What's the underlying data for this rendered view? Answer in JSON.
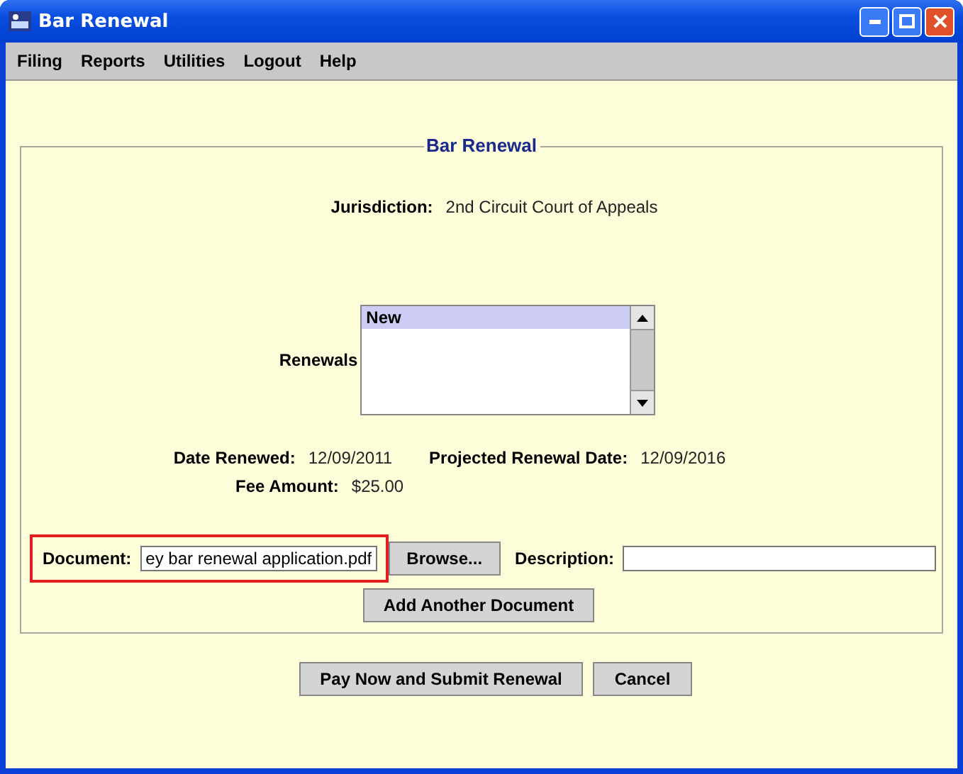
{
  "window": {
    "title": "Bar Renewal"
  },
  "menu": [
    "Filing",
    "Reports",
    "Utilities",
    "Logout",
    "Help"
  ],
  "panel": {
    "title": "Bar Renewal"
  },
  "jurisdiction": {
    "label": "Jurisdiction:",
    "value": "2nd Circuit Court of Appeals"
  },
  "renewals": {
    "label": "Renewals",
    "items": [
      {
        "text": "New",
        "selected": true
      }
    ]
  },
  "dates": [
    {
      "label": "Date Renewed:",
      "value": "12/09/2011"
    },
    {
      "label": "Projected Renewal Date:",
      "value": "12/09/2016"
    }
  ],
  "fee": {
    "label": "Fee Amount:",
    "value": "$25.00"
  },
  "document": {
    "label": "Document:",
    "value": "ey bar renewal application.pdf",
    "highlighted": true
  },
  "browse_button": "Browse...",
  "description": {
    "label": "Description:"
  },
  "add_button": "Add Another Document",
  "actions": [
    "Pay Now and Submit Renewal",
    "Cancel"
  ]
}
